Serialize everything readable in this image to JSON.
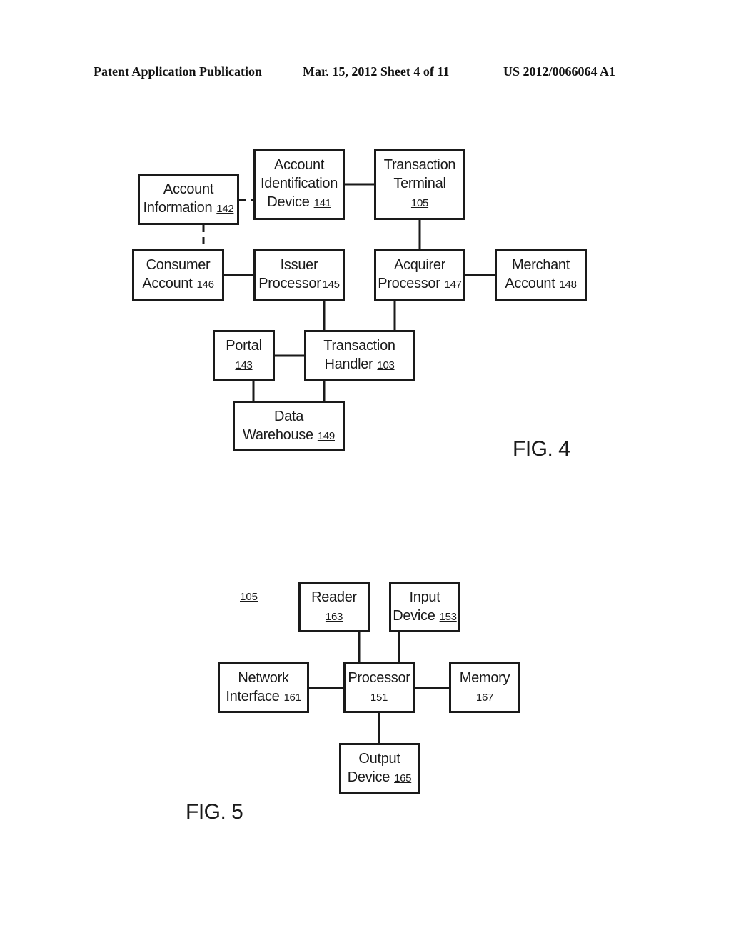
{
  "header": {
    "publication": "Patent Application Publication",
    "date_sheet": "Mar. 15, 2012  Sheet 4 of 11",
    "number": "US 2012/0066064 A1"
  },
  "fig4": {
    "label": "FIG. 4",
    "nodes": {
      "account_information": {
        "line1": "Account",
        "line2": "Information",
        "ref": "142"
      },
      "account_identification_device": {
        "line1": "Account",
        "line2": "Identification",
        "line3": "Device",
        "ref": "141"
      },
      "transaction_terminal": {
        "line1": "Transaction",
        "line2": "Terminal",
        "ref": "105"
      },
      "consumer_account": {
        "line1": "Consumer",
        "line2": "Account",
        "ref": "146"
      },
      "issuer_processor": {
        "line1": "Issuer",
        "line2": "Processor",
        "ref": "145"
      },
      "acquirer_processor": {
        "line1": "Acquirer",
        "line2": "Processor",
        "ref": "147"
      },
      "merchant_account": {
        "line1": "Merchant",
        "line2": "Account",
        "ref": "148"
      },
      "portal": {
        "line1": "Portal",
        "ref": "143"
      },
      "transaction_handler": {
        "line1": "Transaction",
        "line2": "Handler",
        "ref": "103"
      },
      "data_warehouse": {
        "line1": "Data",
        "line2": "Warehouse",
        "ref": "149"
      }
    },
    "edges": [
      {
        "from": "account_information",
        "to": "account_identification_device",
        "style": "dashed"
      },
      {
        "from": "account_information",
        "to": "consumer_account",
        "style": "dashed"
      },
      {
        "from": "account_identification_device",
        "to": "transaction_terminal",
        "style": "solid"
      },
      {
        "from": "transaction_terminal",
        "to": "acquirer_processor",
        "style": "solid"
      },
      {
        "from": "consumer_account",
        "to": "issuer_processor",
        "style": "solid"
      },
      {
        "from": "acquirer_processor",
        "to": "merchant_account",
        "style": "solid"
      },
      {
        "from": "issuer_processor",
        "to": "transaction_handler",
        "style": "solid"
      },
      {
        "from": "acquirer_processor",
        "to": "transaction_handler",
        "style": "solid"
      },
      {
        "from": "portal",
        "to": "transaction_handler",
        "style": "solid"
      },
      {
        "from": "portal",
        "to": "data_warehouse",
        "style": "solid"
      },
      {
        "from": "transaction_handler",
        "to": "data_warehouse",
        "style": "solid"
      }
    ]
  },
  "fig5": {
    "label": "FIG. 5",
    "system_ref": "105",
    "nodes": {
      "reader": {
        "line1": "Reader",
        "ref": "163"
      },
      "input_device": {
        "line1": "Input",
        "line2": "Device",
        "ref": "153"
      },
      "network_interface": {
        "line1": "Network",
        "line2": "Interface",
        "ref": "161"
      },
      "processor": {
        "line1": "Processor",
        "ref": "151"
      },
      "memory": {
        "line1": "Memory",
        "ref": "167"
      },
      "output_device": {
        "line1": "Output",
        "line2": "Device",
        "ref": "165"
      }
    },
    "edges": [
      {
        "from": "reader",
        "to": "processor",
        "style": "solid"
      },
      {
        "from": "input_device",
        "to": "processor",
        "style": "solid"
      },
      {
        "from": "network_interface",
        "to": "processor",
        "style": "solid"
      },
      {
        "from": "processor",
        "to": "memory",
        "style": "solid"
      },
      {
        "from": "processor",
        "to": "output_device",
        "style": "solid"
      }
    ]
  }
}
